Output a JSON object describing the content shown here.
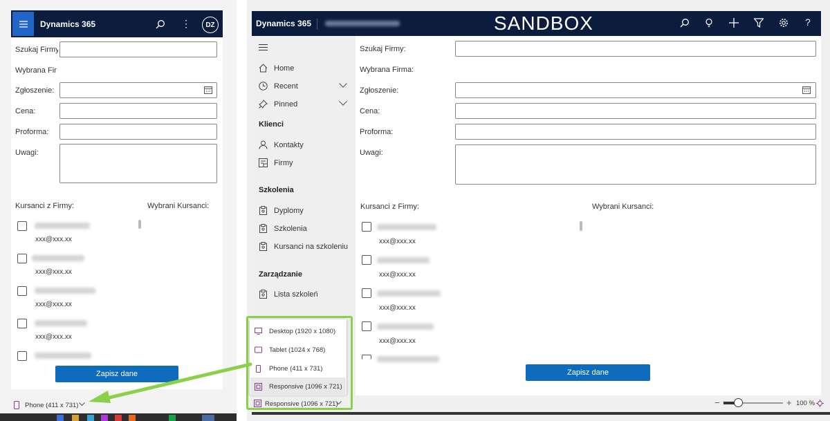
{
  "phone_view": {
    "app_title": "Dynamics 365",
    "avatar_initials": "DZ",
    "labels": {
      "search_firm": "Szukaj Firmy",
      "selected_firm": "Wybrana Fir",
      "ticket": "Zgłoszenie:",
      "price": "Cena:",
      "proforma": "Proforma:",
      "notes": "Uwagi:",
      "trainees_from_firm": "Kursanci z Firmy:",
      "selected_trainees": "Wybrani Kursanci:"
    },
    "trainees": [
      {
        "email": "xxx@xxx.xx"
      },
      {
        "email": "xxx@xxx.xx"
      },
      {
        "email": "xxx@xxx.xx"
      },
      {
        "email": "xxx@xxx.xx"
      }
    ],
    "save_button": "Zapisz dane",
    "device_selector": "Phone (411 x 731)"
  },
  "desktop_view": {
    "app_title": "Dynamics 365",
    "environment_banner": "SANDBOX",
    "sidebar": {
      "items": [
        {
          "label": "Home"
        },
        {
          "label": "Recent"
        },
        {
          "label": "Pinned"
        }
      ],
      "sections": [
        {
          "title": "Klienci",
          "items": [
            {
              "label": "Kontakty"
            },
            {
              "label": "Firmy"
            }
          ]
        },
        {
          "title": "Szkolenia",
          "items": [
            {
              "label": "Dyplomy"
            },
            {
              "label": "Szkolenia"
            },
            {
              "label": "Kursanci na szkoleniu"
            }
          ]
        },
        {
          "title": "Zarządzanie",
          "items": [
            {
              "label": "Lista szkoleń"
            }
          ]
        }
      ]
    },
    "labels": {
      "search_firm": "Szukaj Firmy:",
      "selected_firm": "Wybrana Firma:",
      "ticket": "Zgłoszenie:",
      "price": "Cena:",
      "proforma": "Proforma:",
      "notes": "Uwagi:",
      "trainees_from_firm": "Kursanci z Firmy:",
      "selected_trainees": "Wybrani Kursanci:"
    },
    "trainees": [
      {
        "email": "xxx@xxx.xx"
      },
      {
        "email": "xxx@xxx.xx"
      },
      {
        "email": "xxx@xxx.xx"
      },
      {
        "email": "xxx@xxx.xx"
      }
    ],
    "save_button": "Zapisz dane",
    "zoom_level": "100 %",
    "device_menu": {
      "options": [
        {
          "label": "Desktop (1920 x 1080)",
          "icon": "monitor-icon"
        },
        {
          "label": "Tablet (1024 x 768)",
          "icon": "tablet-icon"
        },
        {
          "label": "Phone (411 x 731)",
          "icon": "phone-icon"
        },
        {
          "label": "Responsive (1096 x 721)",
          "icon": "responsive-icon"
        }
      ],
      "selected": "Responsive (1096 x 721)"
    }
  },
  "colors": {
    "header_navy": "#0b1c3e",
    "button_blue": "#0f6cbd",
    "highlight_green": "#8bd04a"
  }
}
